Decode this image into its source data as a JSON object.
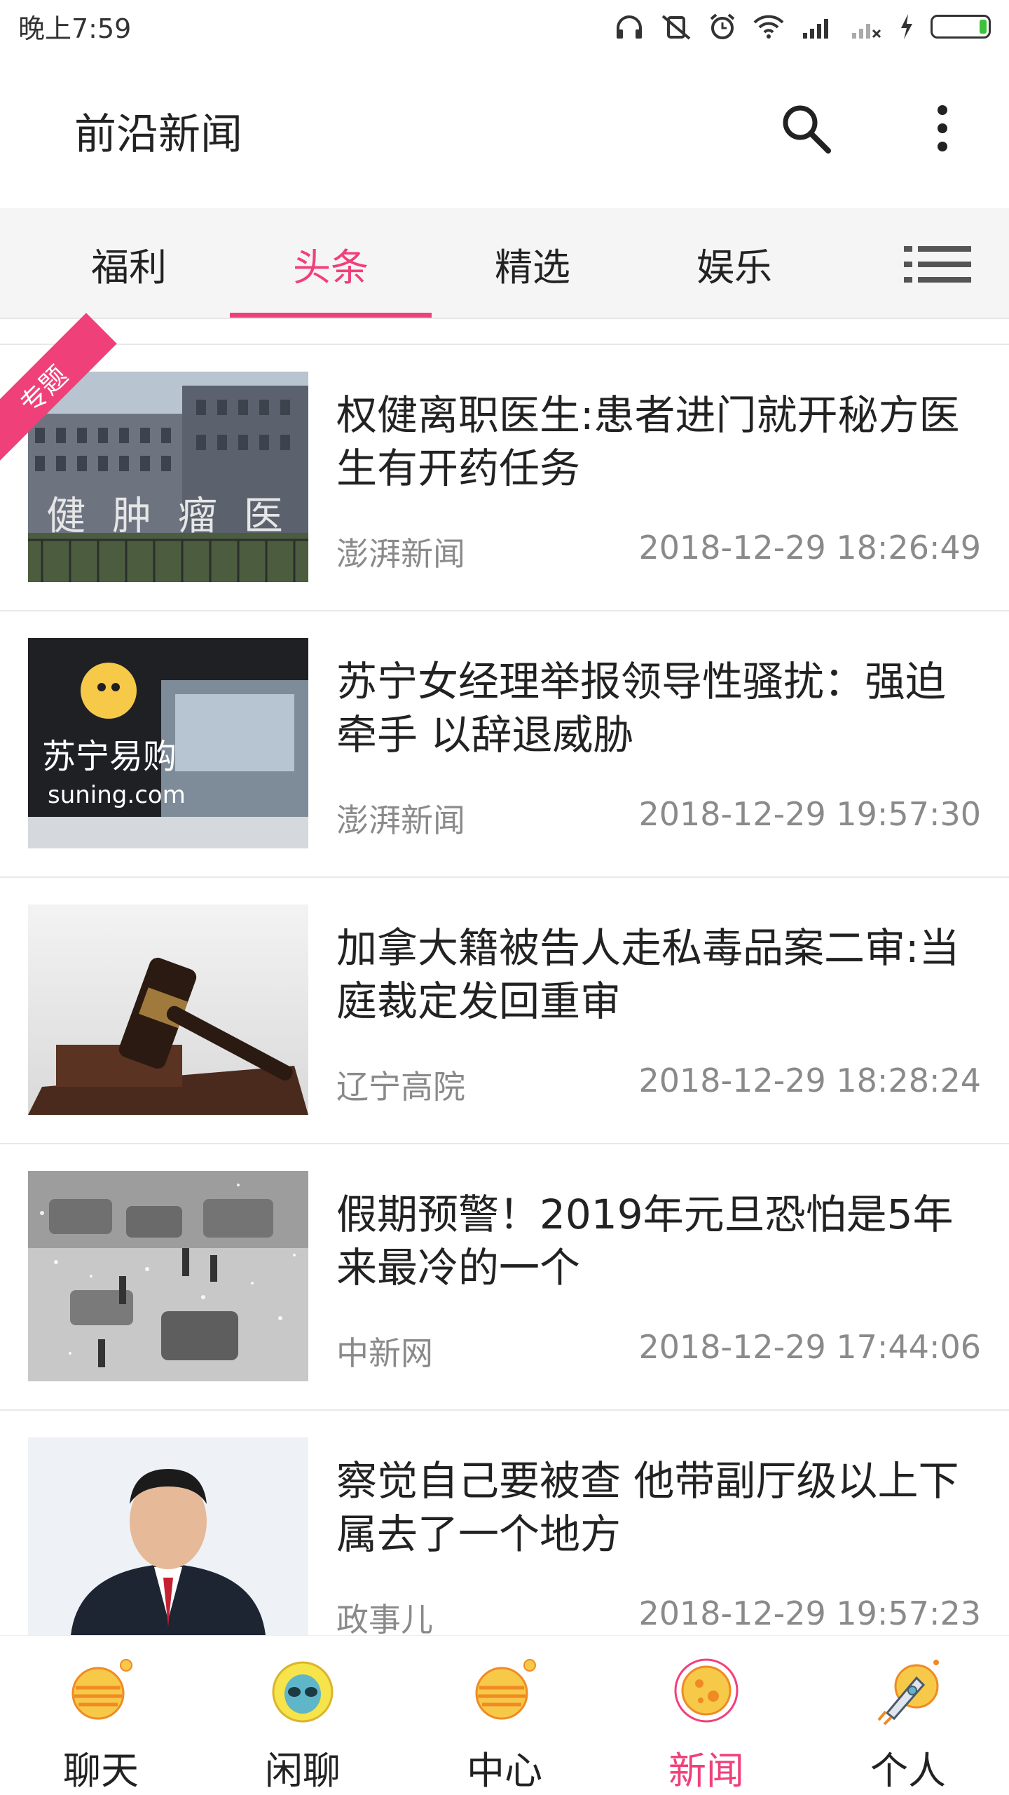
{
  "status_bar": {
    "time": "晚上7:59",
    "icons": [
      "headphones-icon",
      "vibrate-off-icon",
      "alarm-icon",
      "wifi-icon",
      "signal-icon",
      "signal-off-icon",
      "charging-icon",
      "battery-icon"
    ]
  },
  "app_bar": {
    "title": "前沿新闻",
    "icons": [
      "search-icon",
      "more-vert-icon"
    ]
  },
  "tabs": {
    "items": [
      "福利",
      "头条",
      "精选",
      "娱乐"
    ],
    "active": "头条",
    "menu_icon": "menu-list-icon"
  },
  "news": [
    {
      "headline": "权健离职医生:患者进门就开秘方医生有开药任务",
      "source": "澎湃新闻",
      "time": "2018-12-29 18:26:49",
      "badge": "专题"
    },
    {
      "headline": "苏宁女经理举报领导性骚扰：强迫牵手 以辞退威胁",
      "source": "澎湃新闻",
      "time": "2018-12-29 19:57:30"
    },
    {
      "headline": "加拿大籍被告人走私毒品案二审:当庭裁定发回重审",
      "source": "辽宁高院",
      "time": "2018-12-29 18:28:24"
    },
    {
      "headline": "假期预警！2019年元旦恐怕是5年来最冷的一个",
      "source": "中新网",
      "time": "2018-12-29 17:44:06"
    },
    {
      "headline": "察觉自己要被查 他带副厅级以上下属去了一个地方",
      "source": "政事儿",
      "time": "2018-12-29 19:57:23"
    }
  ],
  "thumb_texts": {
    "hospital_sign": "健 肿 瘤 医",
    "suning_brand": "苏宁易购",
    "suning_url": "suning.com"
  },
  "bottom_nav": {
    "items": [
      "聊天",
      "闲聊",
      "中心",
      "新闻",
      "个人"
    ],
    "active": "新闻"
  },
  "colors": {
    "accent": "#f0407a",
    "icon_yellow": "#f7c948",
    "icon_orange": "#f08a24"
  }
}
